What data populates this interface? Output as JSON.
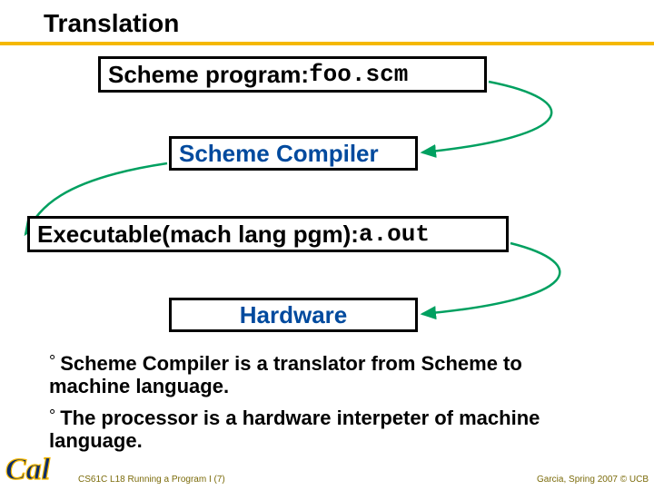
{
  "title": "Translation",
  "boxes": {
    "program_label": "Scheme program: ",
    "program_file": "foo.scm",
    "compiler": "Scheme Compiler",
    "exec_label": "Executable(mach lang pgm): ",
    "exec_file": "a.out",
    "hardware": "Hardware"
  },
  "bullets": {
    "b1": "Scheme Compiler is a translator from Scheme to machine language.",
    "b2": "The processor is a hardware interpeter of machine language."
  },
  "footer": {
    "left": "CS61C L18 Running a Program I (7)",
    "right": "Garcia, Spring 2007 © UCB"
  },
  "logo_alt": "Cal"
}
